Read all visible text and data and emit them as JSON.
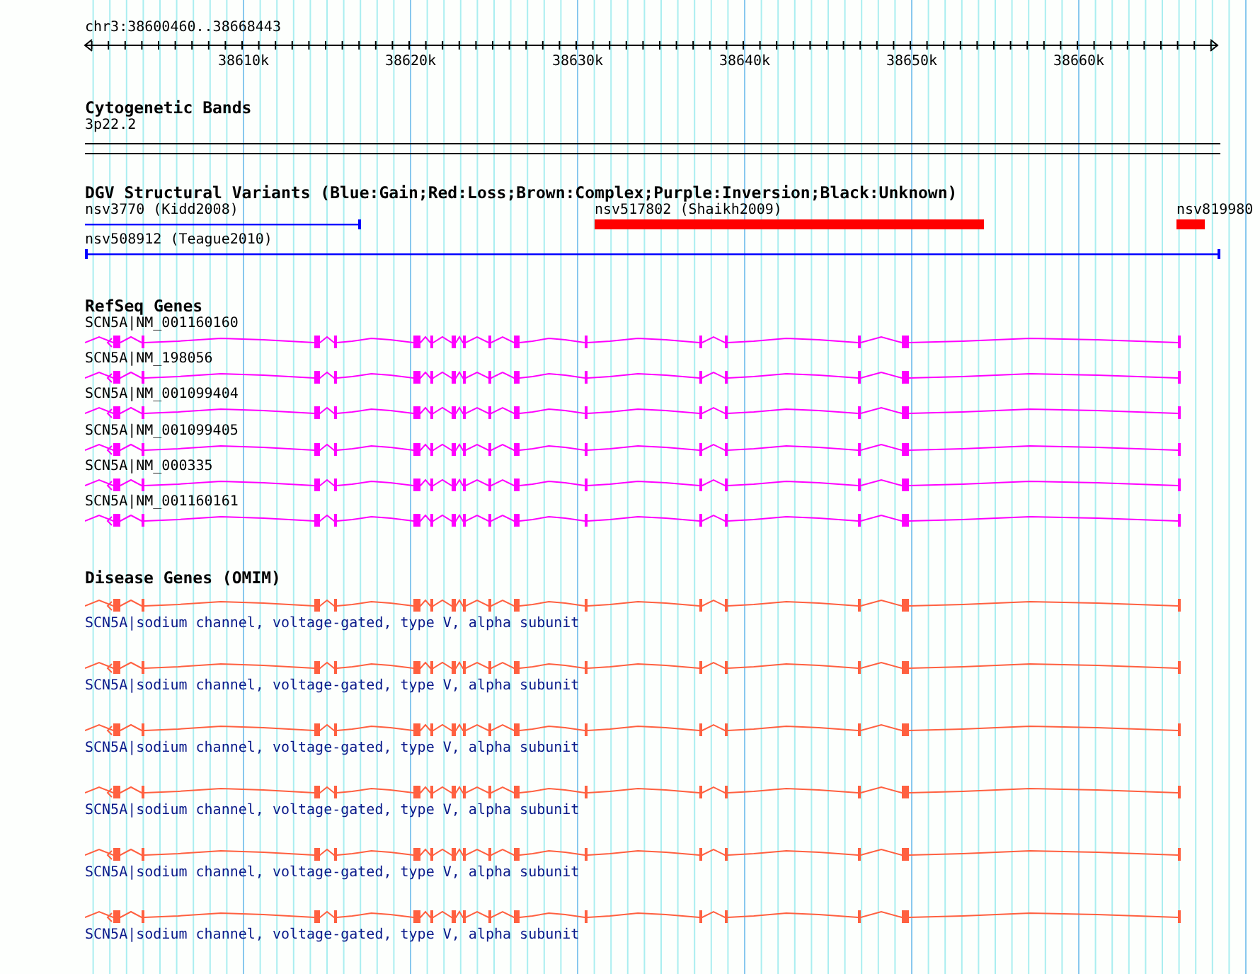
{
  "ruler": {
    "position": "chr3:38600460..38668443",
    "ticks": [
      "38610k",
      "38620k",
      "38630k",
      "38640k",
      "38650k",
      "38660k"
    ]
  },
  "tracks": [
    {
      "kind": "bands",
      "title": "Cytogenetic Bands",
      "bands": [
        "3p22.2"
      ]
    },
    {
      "kind": "variants",
      "title": "DGV Structural Variants (Blue:Gain;Red:Loss;Brown:Complex;Purple:Inversion;Black:Unknown)",
      "variants": [
        {
          "label": "nsv3770 (Kidd2008)",
          "kind": "gain"
        },
        {
          "label": "nsv517802 (Shaikh2009)",
          "kind": "loss"
        },
        {
          "label": "nsv819980",
          "kind": "loss"
        },
        {
          "label": "nsv508912 (Teague2010)",
          "kind": "gain"
        }
      ]
    },
    {
      "kind": "refseq",
      "title": "RefSeq Genes",
      "genes": [
        {
          "label": "SCN5A|NM_001160160"
        },
        {
          "label": "SCN5A|NM_198056"
        },
        {
          "label": "SCN5A|NM_001099404"
        },
        {
          "label": "SCN5A|NM_001099405"
        },
        {
          "label": "SCN5A|NM_000335"
        },
        {
          "label": "SCN5A|NM_001160161"
        }
      ]
    },
    {
      "kind": "omim",
      "title": "Disease Genes (OMIM)",
      "genes": [
        {
          "label": "SCN5A|sodium channel, voltage-gated, type V, alpha subunit"
        },
        {
          "label": "SCN5A|sodium channel, voltage-gated, type V, alpha subunit"
        },
        {
          "label": "SCN5A|sodium channel, voltage-gated, type V, alpha subunit"
        },
        {
          "label": "SCN5A|sodium channel, voltage-gated, type V, alpha subunit"
        },
        {
          "label": "SCN5A|sodium channel, voltage-gated, type V, alpha subunit"
        },
        {
          "label": "SCN5A|sodium channel, voltage-gated, type V, alpha subunit"
        }
      ]
    }
  ]
}
